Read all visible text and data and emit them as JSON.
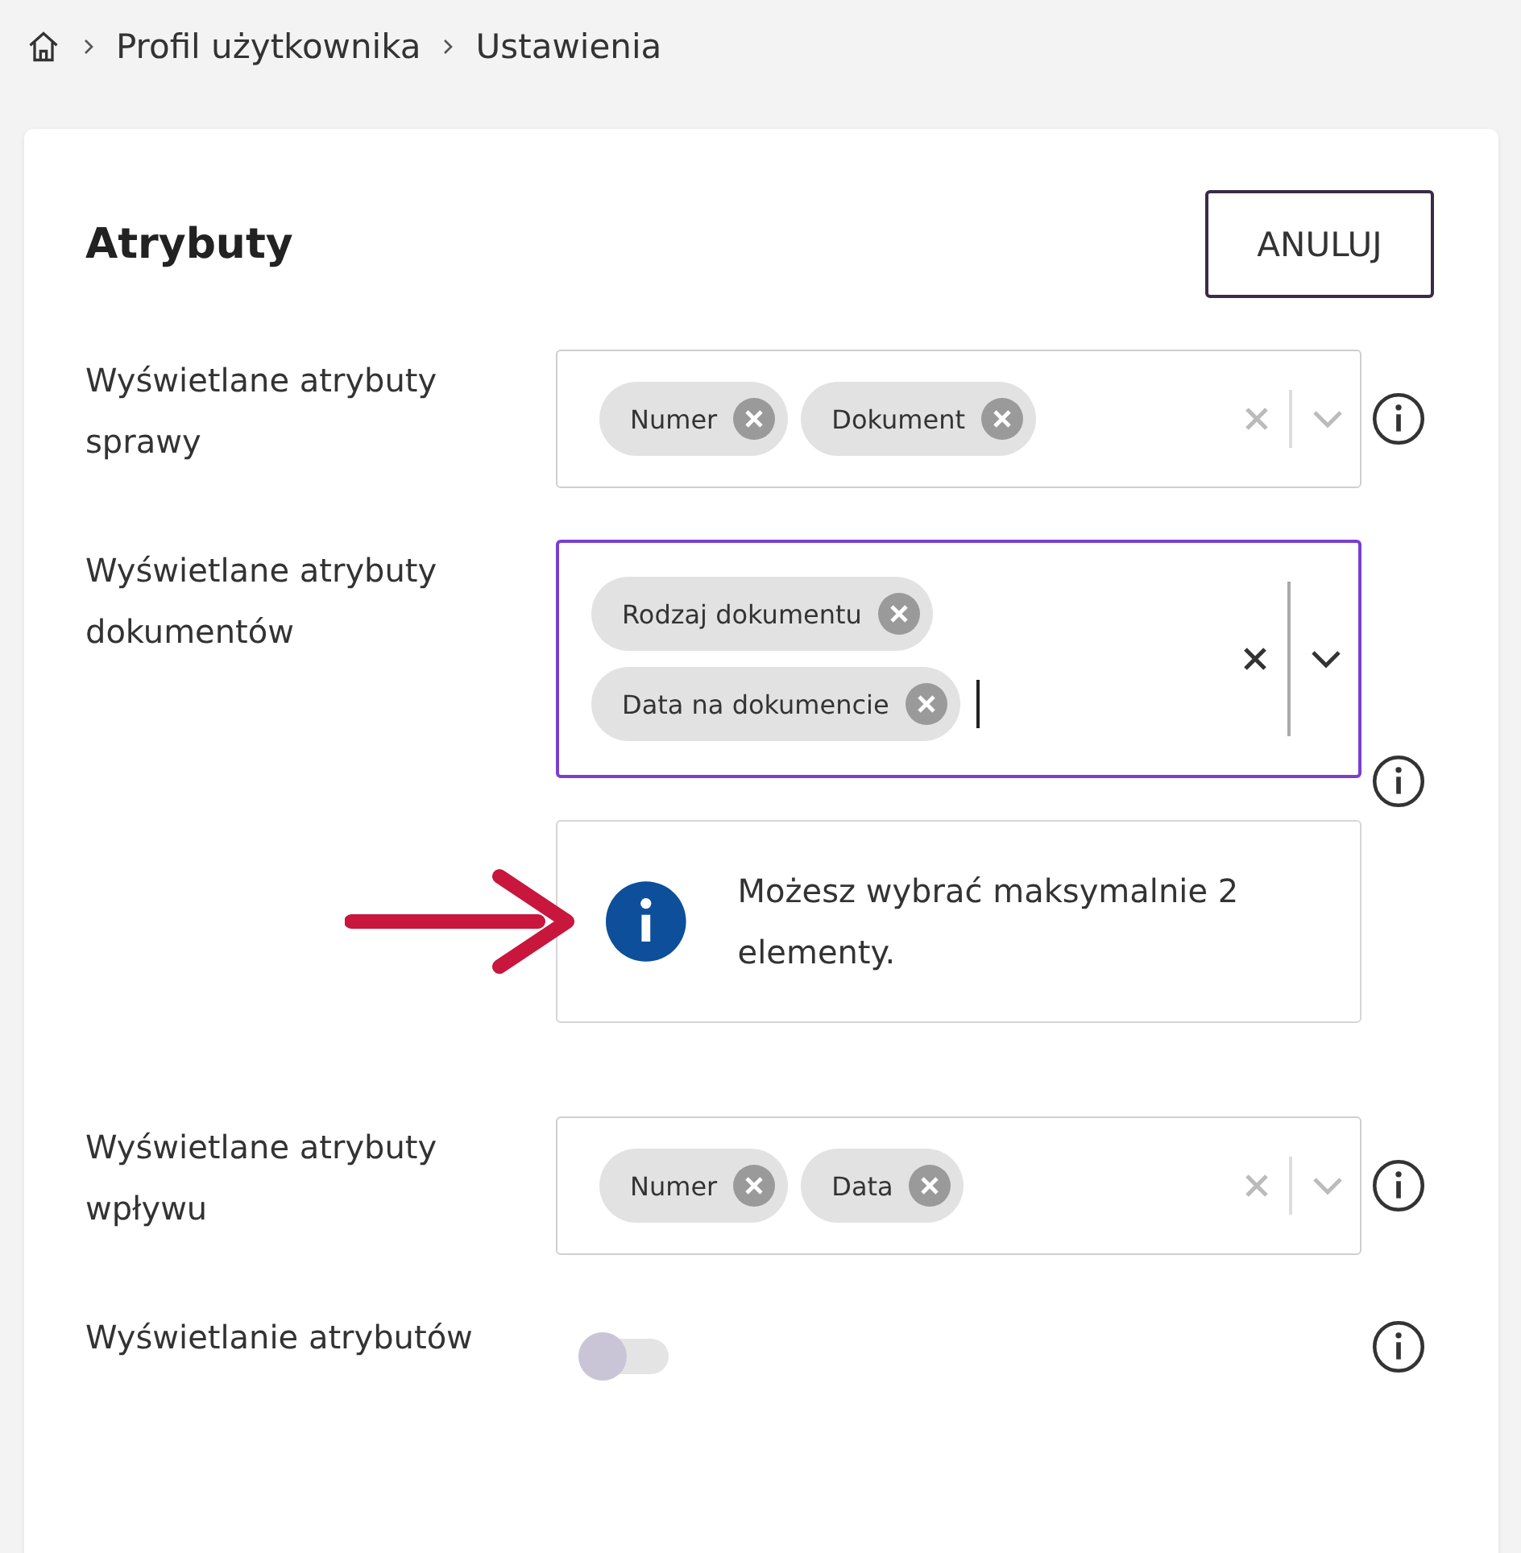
{
  "breadcrumb": {
    "items": [
      "Profil użytkownika",
      "Ustawienia"
    ]
  },
  "card": {
    "title": "Atrybuty",
    "cancel_button": "ANULUJ",
    "fields": [
      {
        "label": "Wyświetlane atrybuty sprawy",
        "focused": false,
        "chips": [
          "Numer",
          "Dokument"
        ]
      },
      {
        "label": "Wyświetlane atrybuty dokumentów",
        "focused": true,
        "chips": [
          "Rodzaj dokumentu",
          "Data na dokumencie"
        ],
        "notice": "Możesz wybrać maksymalnie 2 elementy."
      },
      {
        "label": "Wyświetlane atrybuty wpływu",
        "focused": false,
        "chips": [
          "Numer",
          "Data"
        ]
      }
    ],
    "toggle": {
      "label": "Wyświetlanie atrybutów",
      "on": false
    }
  }
}
